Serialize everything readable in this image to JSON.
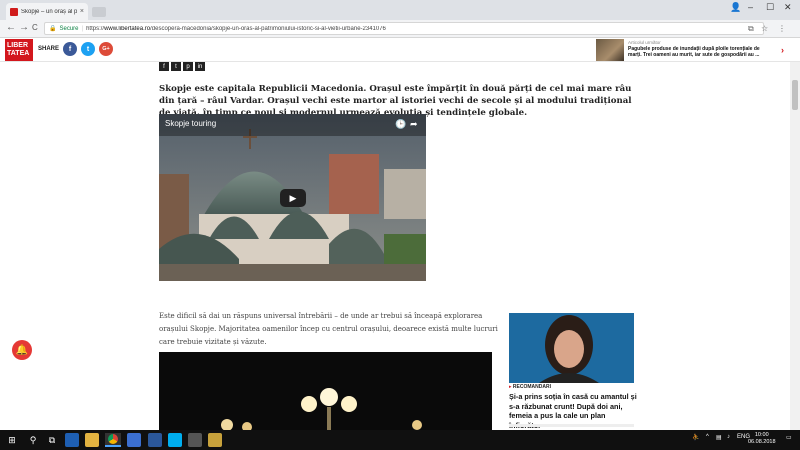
{
  "browser": {
    "tab_title": "Skopje – un oraș al patri...",
    "tab_close": "×",
    "secure_label": "Secure",
    "url_scheme": "https://",
    "url_domain": "www.libertatea.ro",
    "url_path": "/descopera-macedonia/skopje-un-oras-al-patrimoniului-istoric-si-al-vietii-urbane-2341076",
    "nav_back": "←",
    "nav_forward": "→",
    "nav_reload": "C",
    "win_profile": "👤",
    "win_min": "–",
    "win_max": "☐",
    "win_close": "✕",
    "ext_translate": "⧉",
    "ext_star": "☆",
    "ext_menu": "⋮"
  },
  "site": {
    "logo_line1": "LIBER",
    "logo_line2": "TATEA",
    "share_label": "SHARE",
    "share_buttons": [
      "f",
      "t",
      "G+"
    ],
    "related_label": "Articolul următor",
    "related_title": "Pagubele produse de inundații după ploile torențiale de marți. Trei oameni au murit, iar sute de gospodării au ...",
    "related_arrow": "›"
  },
  "article": {
    "mini_share": [
      "f",
      "t",
      "p",
      "in"
    ],
    "lead": "Skopje este capitala Republicii Macedonia. Orașul este împărțit în două părți de cel mai mare râu din țară – râul Vardar. Orașul vechi este martor al istoriei vechi de secole și al modului tradițional de viață, în timp ce noul și modernul urmează evoluția și tendințele globale.",
    "video_title": "Skopje touring",
    "video_clock_icon": "🕒",
    "video_share_icon": "➦",
    "video_play": "▶",
    "body": "Este dificil să dai un răspuns universal întrebării – de unde ar trebui să înceapă explorarea orașului Skopje. Majoritatea oamenilor încep cu centrul orașului, deoarece există multe lucruri care trebuie vizitate și văzute."
  },
  "sidebar": {
    "recommended_arrow": "▸",
    "recommended_label": "RECOMANDARI",
    "ad_title": "Și-a prins soția în casă cu amantul și s-a răzbunat crunt! După doi ani, femeia a pus la cale un plan înfiorător"
  },
  "notification_icon": "🔔",
  "taskbar": {
    "start": "⊞",
    "search": "⚲",
    "taskview": "⧉",
    "lang": "ENG",
    "time": "10:00",
    "date": "06.08.2018"
  },
  "colors": {
    "brand_red": "#d3171d",
    "facebook": "#3b5998",
    "twitter": "#1da1f2",
    "google": "#dd4b39"
  }
}
